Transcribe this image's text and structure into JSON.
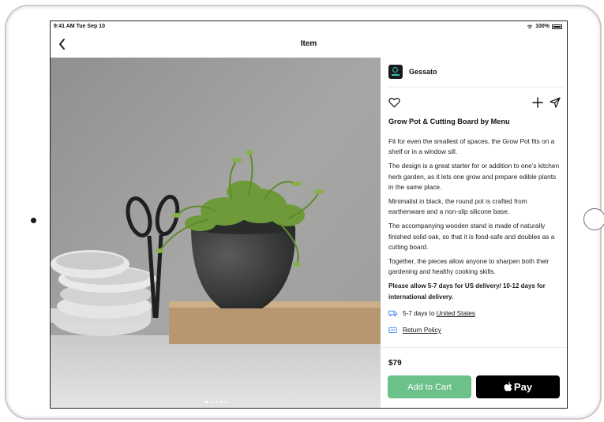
{
  "status": {
    "time": "9:41 AM  Tue Sep 10",
    "battery": "100%"
  },
  "nav": {
    "title": "Item"
  },
  "gallery": {
    "image_count": 5,
    "active_index": 0
  },
  "seller": {
    "name": "Gessato"
  },
  "product": {
    "title": "Grow Pot & Cutting Board by Menu",
    "description": [
      "Fit for even the smallest of spaces, the Grow Pot fits on a shelf or in a window sill.",
      "The design is a great starter for or addition to one’s kitchen herb garden, as it lets one grow and prepare edible plants in the same place.",
      "Minimalist in black, the round pot is crafted from earthenware and a non-slip silicone base.",
      "The accompanying wooden stand is made of naturally finished solid oak, so that it is food-safe and doubles as a cutting board.",
      "Together, the pieces allow anyone to sharpen both their gardening and healthy cooking skills."
    ],
    "delivery_note": "Please allow 5-7 days for US delivery/ 10-12 days for international delivery.",
    "shipping_prefix": "5-7 days to ",
    "shipping_link": "United States",
    "return_policy": "Return Policy",
    "price": "$79"
  },
  "buttons": {
    "add_to_cart": "Add to Cart",
    "pay": "Pay"
  },
  "colors": {
    "cart": "#6cc08a",
    "pay": "#000000",
    "link_icon": "#3b82f6"
  },
  "icons": {
    "back": "chevron-left-icon",
    "like": "heart-icon",
    "add": "plus-icon",
    "share": "send-icon",
    "shipping": "truck-icon",
    "returns": "return-box-icon",
    "pay": "apple-icon"
  }
}
